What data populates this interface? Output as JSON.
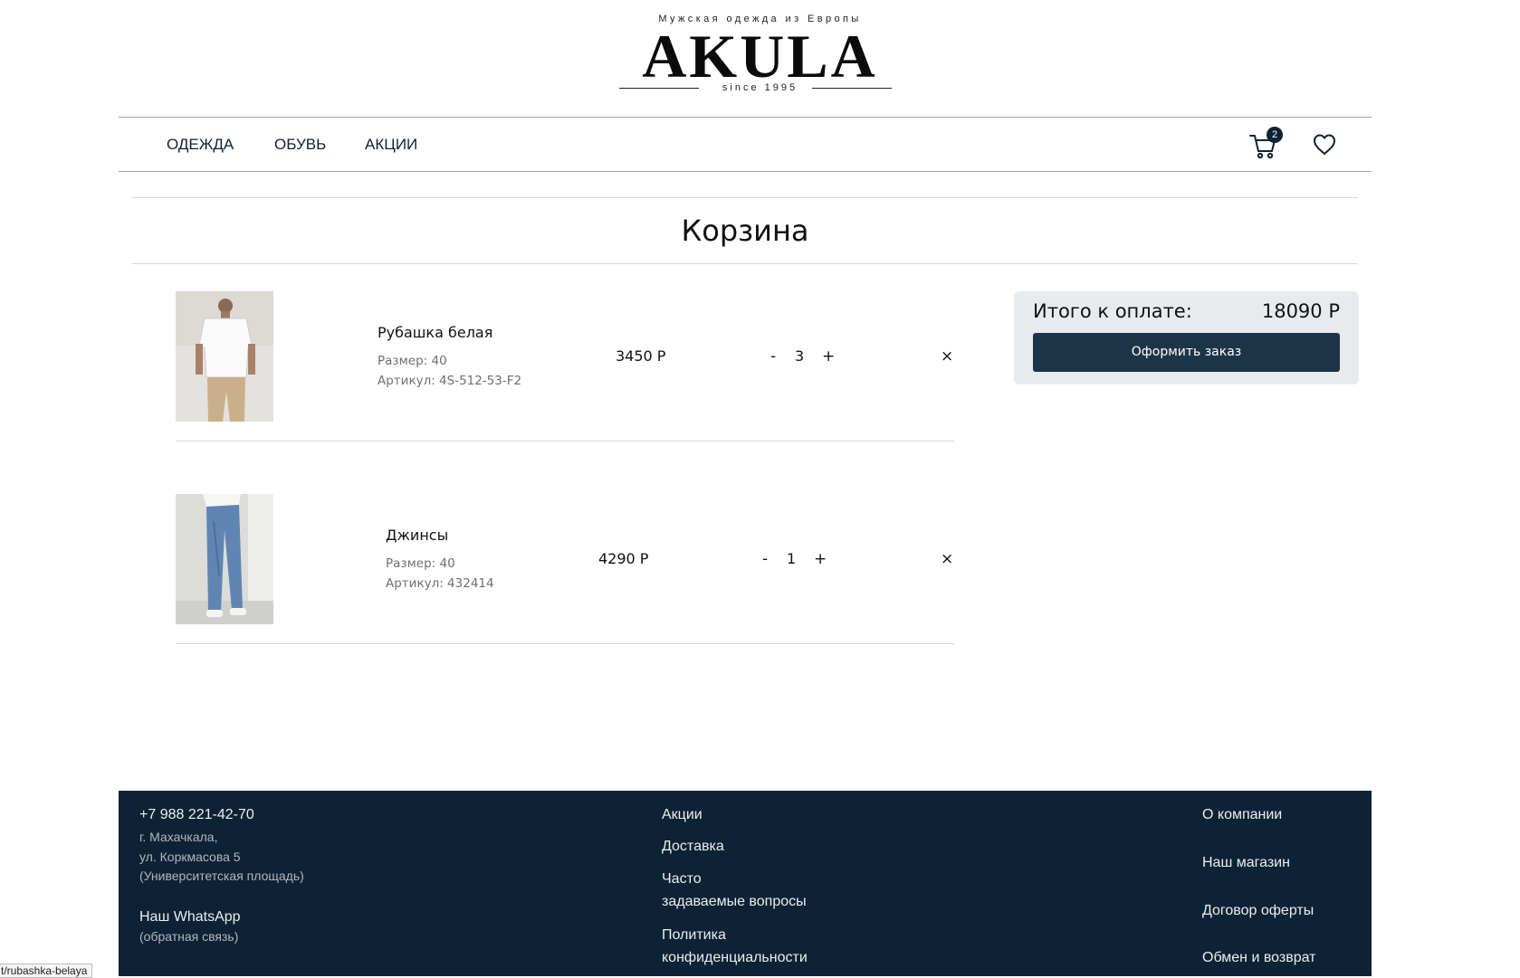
{
  "brand": {
    "tagline": "Мужская одежда из Европы",
    "name": "AKULA",
    "since": "since 1995"
  },
  "nav": {
    "links": [
      "ОДЕЖДА",
      "ОБУВЬ",
      "АКЦИИ"
    ],
    "cart_count": "2",
    "icons": [
      "cart-icon",
      "heart-icon"
    ]
  },
  "page": {
    "title": "Корзина"
  },
  "cart": {
    "items": [
      {
        "name": "Рубашка белая",
        "size": "Размер: 40",
        "sku": "Артикул: 4S-512-53-F2",
        "price": "3450 Р",
        "qty": "3",
        "minus": "-",
        "plus": "+",
        "remove": "×"
      },
      {
        "name": "Джинсы",
        "size": "Размер: 40",
        "sku": "Артикул: 432414",
        "price": "4290 Р",
        "qty": "1",
        "minus": "-",
        "plus": "+",
        "remove": "×"
      }
    ]
  },
  "summary": {
    "label": "Итого к оплате:",
    "total": "18090 Р",
    "checkout_label": "Оформить заказ"
  },
  "footer": {
    "phone": "+7 988 221-42-70",
    "address": [
      "г. Махачкала,",
      "ул. Коркмасова 5",
      "(Университетская площадь)"
    ],
    "whatsapp": "Наш WhatsApp",
    "whatsapp_note": "(обратная связь)",
    "col2": [
      "Акции",
      "Доставка",
      "Часто",
      "задаваемые вопросы",
      "Политика",
      "конфиденциальности"
    ],
    "col3": [
      "О компании",
      "Наш магазин",
      "Договор оферты",
      "Обмен и возврат"
    ]
  },
  "status_url": "t/rubashka-belaya",
  "colors": {
    "navy": "#0e2235",
    "button": "#1c3448",
    "summary_bg": "#e8ebee"
  }
}
